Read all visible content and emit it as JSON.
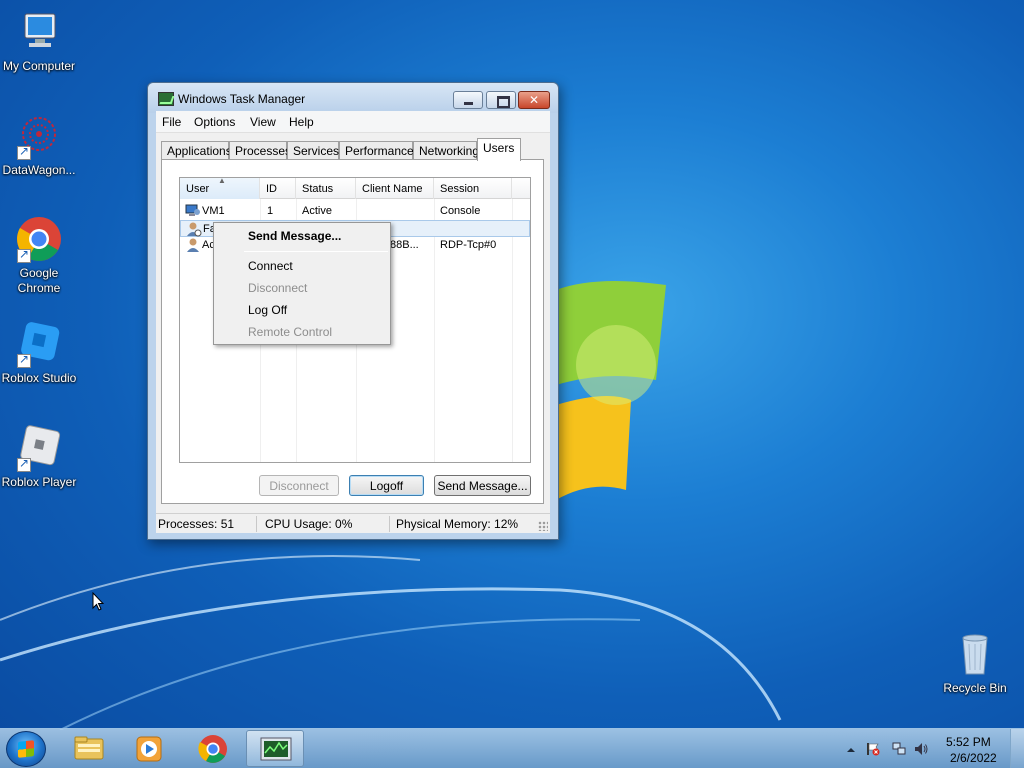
{
  "desktop": {
    "icons": [
      {
        "label": "My Computer"
      },
      {
        "label": "DataWagon..."
      },
      {
        "label": "Google Chrome"
      },
      {
        "label": "Roblox Studio"
      },
      {
        "label": "Roblox Player"
      },
      {
        "label": "Recycle Bin"
      }
    ]
  },
  "window": {
    "title": "Windows Task Manager",
    "menu": [
      "File",
      "Options",
      "View",
      "Help"
    ],
    "tabs": [
      "Applications",
      "Processes",
      "Services",
      "Performance",
      "Networking",
      "Users"
    ],
    "active_tab": "Users",
    "columns": [
      "User",
      "ID",
      "Status",
      "Client Name",
      "Session"
    ],
    "rows": [
      {
        "user": "VM1",
        "id": "1",
        "status": "Active",
        "client": "",
        "session": "Console"
      },
      {
        "user": "Fa",
        "id": "",
        "status": "",
        "client": "",
        "session": ""
      },
      {
        "user": "Ac",
        "id": "",
        "status": "",
        "client": "88B...",
        "session": "RDP-Tcp#0"
      }
    ],
    "buttons": {
      "disconnect": "Disconnect",
      "logoff": "Logoff",
      "send_message": "Send Message..."
    },
    "status": {
      "processes": "Processes: 51",
      "cpu": "CPU Usage: 0%",
      "memory": "Physical Memory: 12%"
    }
  },
  "context_menu": {
    "items": [
      {
        "label": "Send Message...",
        "bold": true,
        "enabled": true
      },
      {
        "label": "Connect",
        "enabled": true
      },
      {
        "label": "Disconnect",
        "enabled": false
      },
      {
        "label": "Log Off",
        "enabled": true
      },
      {
        "label": "Remote Control",
        "enabled": false
      }
    ]
  },
  "taskbar": {
    "pinned": [
      "windows-explorer-icon",
      "media-player-icon",
      "chrome-icon",
      "task-manager-icon"
    ],
    "active": "task-manager-icon",
    "clock": {
      "time": "5:52 PM",
      "date": "2/6/2022"
    }
  },
  "colors": {
    "desktop": "#1c7ed3",
    "selection": "#e6f0fa",
    "close_button": "#c8462b"
  }
}
